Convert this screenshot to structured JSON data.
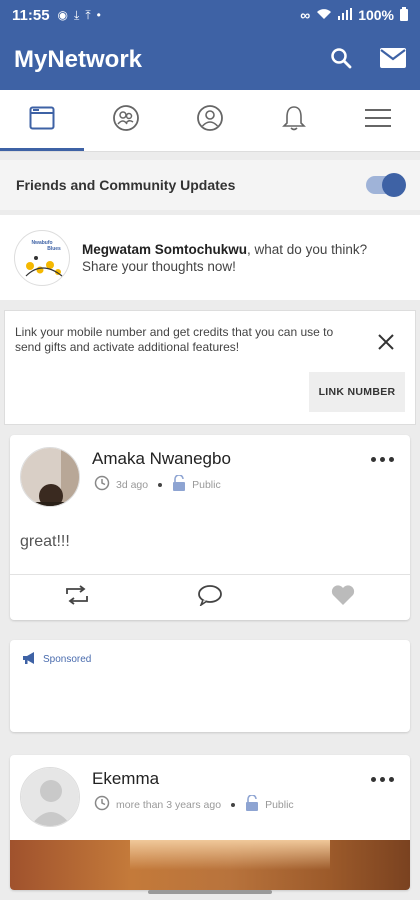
{
  "status": {
    "time": "11:55",
    "battery": "100%"
  },
  "app": {
    "title": "MyNetwork"
  },
  "tabs": [
    {
      "id": "feed",
      "icon": "news-feed-icon",
      "active": true
    },
    {
      "id": "community",
      "icon": "community-icon",
      "active": false
    },
    {
      "id": "profile",
      "icon": "profile-icon",
      "active": false
    },
    {
      "id": "notifications",
      "icon": "bell-icon",
      "active": false
    },
    {
      "id": "menu",
      "icon": "hamburger-menu-icon",
      "active": false
    }
  ],
  "feed_header": {
    "label": "Friends and Community Updates",
    "toggle_on": true
  },
  "compose": {
    "logo_text": "Nwabufo Blues",
    "name": "Megwatam Somtochukwu",
    "prompt": ", what do you think? Share your thoughts now!"
  },
  "link_card": {
    "message": "Link your mobile number and get credits that you can use to send gifts and activate additional features!",
    "button": "LINK NUMBER"
  },
  "posts": [
    {
      "name": "Amaka Nwanegbo",
      "time": "3d ago",
      "privacy": "Public",
      "body": "great!!!"
    },
    {
      "name": "Ekemma",
      "time": "more than 3 years ago",
      "privacy": "Public"
    }
  ],
  "sponsored": {
    "label": "Sponsored"
  },
  "colors": {
    "brand": "#3e62a5",
    "accent_light": "#9fb3d8",
    "background": "#ececec"
  }
}
